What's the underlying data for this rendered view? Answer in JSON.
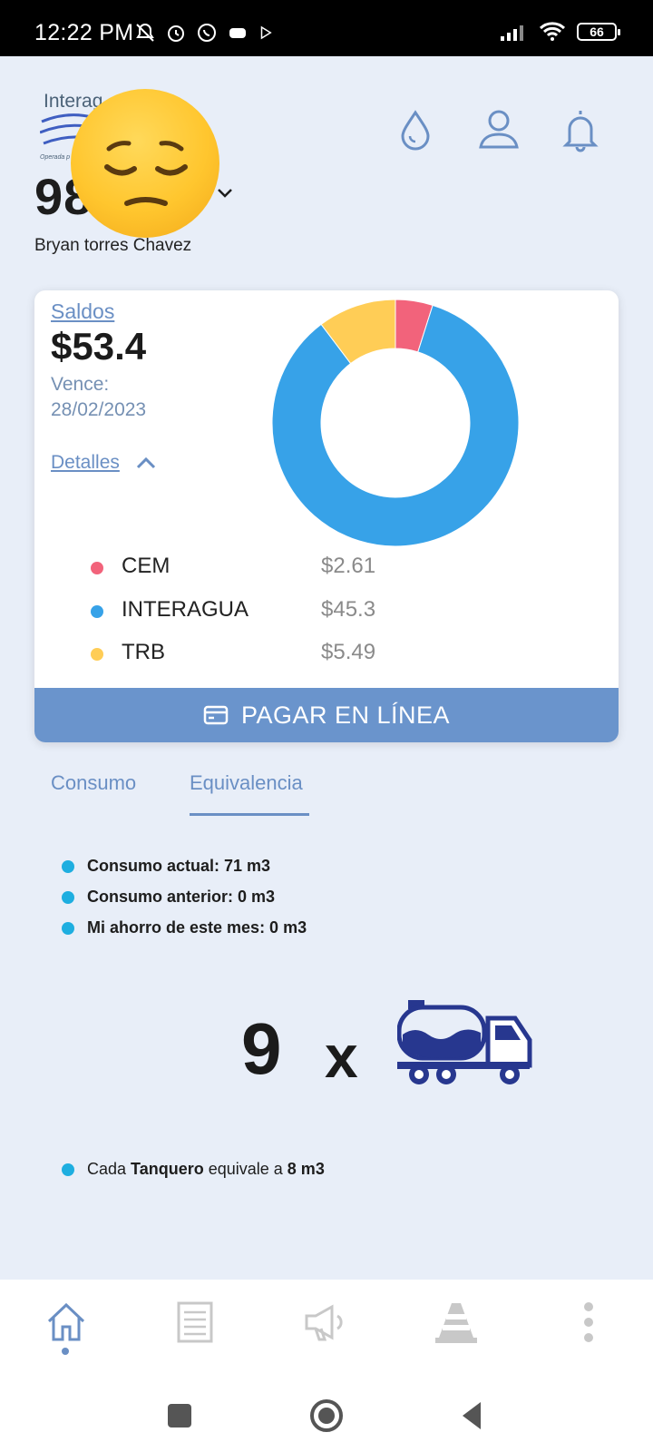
{
  "status_bar": {
    "time": "12:22 PM",
    "battery": "66"
  },
  "header": {
    "logo_text": "Interag",
    "logo_sub": "Operada p",
    "account_number": "98",
    "user_name": "Bryan torres Chavez"
  },
  "balance_card": {
    "saldos_label": "Saldos",
    "amount": "$53.4",
    "vence_label": "Vence:",
    "vence_date": "28/02/2023",
    "details_label": "Detalles",
    "pay_button_label": "PAGAR EN LÍNEA",
    "items": [
      {
        "name": "CEM",
        "value": "$2.61",
        "color": "#f2637b"
      },
      {
        "name": "INTERAGUA",
        "value": "$45.3",
        "color": "#37a2e8"
      },
      {
        "name": "TRB",
        "value": "$5.49",
        "color": "#ffcd56"
      }
    ]
  },
  "tabs": {
    "consumo": "Consumo",
    "equivalencia": "Equivalencia",
    "active": "equivalencia"
  },
  "consumption": {
    "current": "Consumo actual: 71 m3",
    "previous": "Consumo anterior: 0 m3",
    "savings": "Mi ahorro de este mes: 0 m3"
  },
  "equivalence": {
    "count": "9",
    "multiplier": "x",
    "note_prefix": "Cada ",
    "note_bold": "Tanquero",
    "note_middle": " equivale a ",
    "note_value": "8 m3"
  },
  "colors": {
    "accent": "#6a94cc",
    "link": "#6a8fc4",
    "bullet": "#1eaee0",
    "truck": "#27378f",
    "background": "#e8eef8"
  }
}
